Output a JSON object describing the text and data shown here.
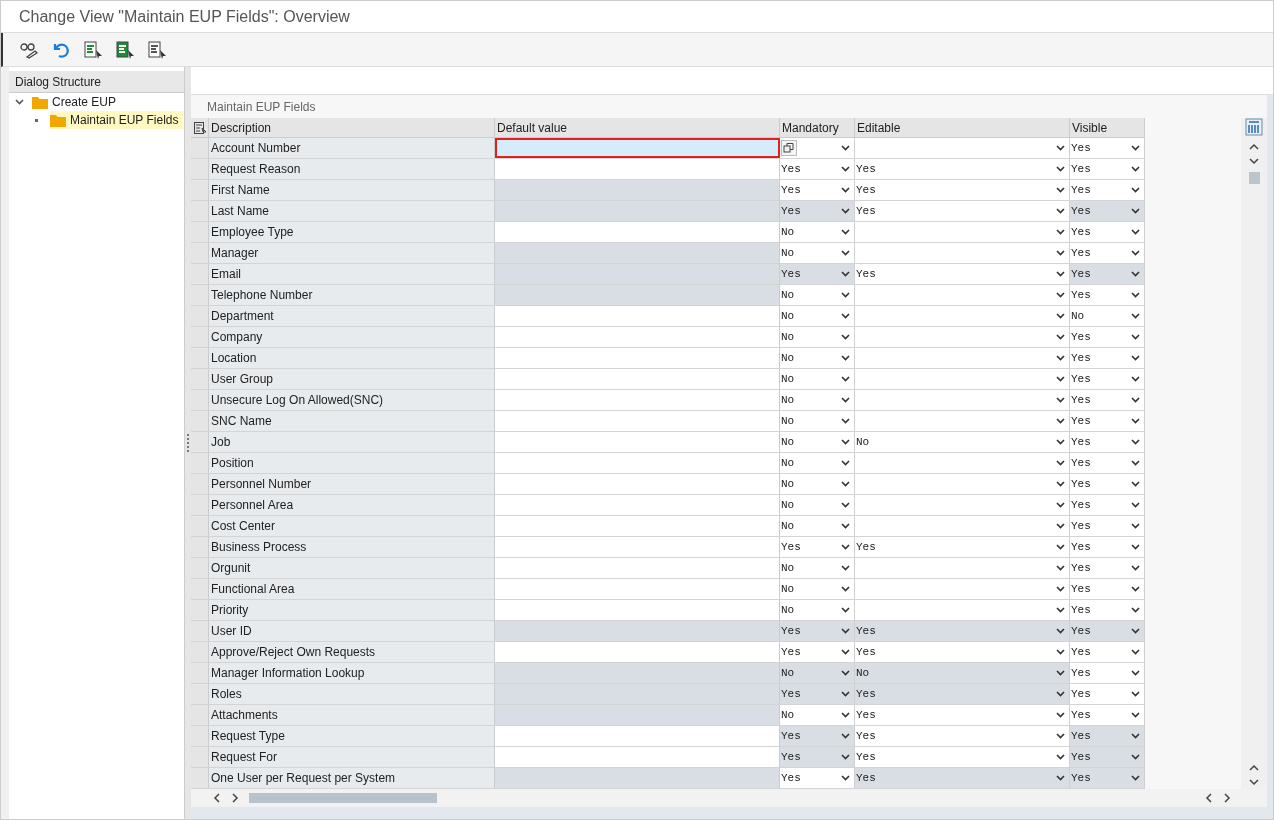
{
  "window": {
    "title": "Change View \"Maintain EUP Fields\": Overview"
  },
  "dialog_structure": {
    "title": "Dialog Structure",
    "tree": [
      {
        "label": "Create EUP",
        "expanded": true,
        "selected": false,
        "children": [
          {
            "label": "Maintain EUP Fields",
            "selected": true
          }
        ]
      }
    ]
  },
  "table": {
    "title": "Maintain EUP Fields",
    "columns": [
      "Description",
      "Default value",
      "Mandatory",
      "Editable",
      "Visible"
    ],
    "rows": [
      {
        "description": "Account Number",
        "default_value": {
          "disabled": false,
          "focused": true
        },
        "mandatory": {
          "disabled": false
        },
        "editable": {
          "disabled": false
        },
        "visible": {
          "value": "Yes",
          "disabled": false
        }
      },
      {
        "description": "Request Reason",
        "default_value": {
          "disabled": false,
          "focused": false
        },
        "mandatory": {
          "value": "Yes",
          "disabled": false
        },
        "editable": {
          "value": "Yes",
          "disabled": false
        },
        "visible": {
          "value": "Yes",
          "disabled": false
        }
      },
      {
        "description": "First Name",
        "default_value": {
          "disabled": true,
          "focused": false
        },
        "mandatory": {
          "value": "Yes",
          "disabled": false
        },
        "editable": {
          "value": "Yes",
          "disabled": false
        },
        "visible": {
          "value": "Yes",
          "disabled": false
        }
      },
      {
        "description": "Last Name",
        "default_value": {
          "disabled": true,
          "focused": false
        },
        "mandatory": {
          "value": "Yes",
          "disabled": true
        },
        "editable": {
          "value": "Yes",
          "disabled": false
        },
        "visible": {
          "value": "Yes",
          "disabled": true
        }
      },
      {
        "description": "Employee Type",
        "default_value": {
          "disabled": false,
          "focused": false
        },
        "mandatory": {
          "value": "No",
          "disabled": false
        },
        "editable": {
          "disabled": false
        },
        "visible": {
          "value": "Yes",
          "disabled": false
        }
      },
      {
        "description": "Manager",
        "default_value": {
          "disabled": true,
          "focused": false
        },
        "mandatory": {
          "value": "No",
          "disabled": false
        },
        "editable": {
          "disabled": false
        },
        "visible": {
          "value": "Yes",
          "disabled": false
        }
      },
      {
        "description": "Email",
        "default_value": {
          "disabled": true,
          "focused": false
        },
        "mandatory": {
          "value": "Yes",
          "disabled": true
        },
        "editable": {
          "value": "Yes",
          "disabled": false
        },
        "visible": {
          "value": "Yes",
          "disabled": true
        }
      },
      {
        "description": "Telephone Number",
        "default_value": {
          "disabled": true,
          "focused": false
        },
        "mandatory": {
          "value": "No",
          "disabled": false
        },
        "editable": {
          "disabled": false
        },
        "visible": {
          "value": "Yes",
          "disabled": false
        }
      },
      {
        "description": "Department",
        "default_value": {
          "disabled": false,
          "focused": false
        },
        "mandatory": {
          "value": "No",
          "disabled": false
        },
        "editable": {
          "disabled": false
        },
        "visible": {
          "value": "No",
          "disabled": false
        }
      },
      {
        "description": "Company",
        "default_value": {
          "disabled": false,
          "focused": false
        },
        "mandatory": {
          "value": "No",
          "disabled": false
        },
        "editable": {
          "disabled": false
        },
        "visible": {
          "value": "Yes",
          "disabled": false
        }
      },
      {
        "description": "Location",
        "default_value": {
          "disabled": false,
          "focused": false
        },
        "mandatory": {
          "value": "No",
          "disabled": false
        },
        "editable": {
          "disabled": false
        },
        "visible": {
          "value": "Yes",
          "disabled": false
        }
      },
      {
        "description": "User Group",
        "default_value": {
          "disabled": false,
          "focused": false
        },
        "mandatory": {
          "value": "No",
          "disabled": false
        },
        "editable": {
          "disabled": false
        },
        "visible": {
          "value": "Yes",
          "disabled": false
        }
      },
      {
        "description": "Unsecure Log On Allowed(SNC)",
        "default_value": {
          "disabled": false,
          "focused": false
        },
        "mandatory": {
          "value": "No",
          "disabled": false
        },
        "editable": {
          "disabled": false
        },
        "visible": {
          "value": "Yes",
          "disabled": false
        }
      },
      {
        "description": "SNC Name",
        "default_value": {
          "disabled": false,
          "focused": false
        },
        "mandatory": {
          "value": "No",
          "disabled": false
        },
        "editable": {
          "disabled": false
        },
        "visible": {
          "value": "Yes",
          "disabled": false
        }
      },
      {
        "description": "Job",
        "default_value": {
          "disabled": false,
          "focused": false
        },
        "mandatory": {
          "value": "No",
          "disabled": false
        },
        "editable": {
          "value": "No",
          "disabled": false
        },
        "visible": {
          "value": "Yes",
          "disabled": false
        }
      },
      {
        "description": "Position",
        "default_value": {
          "disabled": false,
          "focused": false
        },
        "mandatory": {
          "value": "No",
          "disabled": false
        },
        "editable": {
          "disabled": false
        },
        "visible": {
          "value": "Yes",
          "disabled": false
        }
      },
      {
        "description": "Personnel Number",
        "default_value": {
          "disabled": false,
          "focused": false
        },
        "mandatory": {
          "value": "No",
          "disabled": false
        },
        "editable": {
          "disabled": false
        },
        "visible": {
          "value": "Yes",
          "disabled": false
        }
      },
      {
        "description": "Personnel Area",
        "default_value": {
          "disabled": false,
          "focused": false
        },
        "mandatory": {
          "value": "No",
          "disabled": false
        },
        "editable": {
          "disabled": false
        },
        "visible": {
          "value": "Yes",
          "disabled": false
        }
      },
      {
        "description": "Cost Center",
        "default_value": {
          "disabled": false,
          "focused": false
        },
        "mandatory": {
          "value": "No",
          "disabled": false
        },
        "editable": {
          "disabled": false
        },
        "visible": {
          "value": "Yes",
          "disabled": false
        }
      },
      {
        "description": "Business Process",
        "default_value": {
          "disabled": false,
          "focused": false
        },
        "mandatory": {
          "value": "Yes",
          "disabled": false
        },
        "editable": {
          "value": "Yes",
          "disabled": false
        },
        "visible": {
          "value": "Yes",
          "disabled": false
        }
      },
      {
        "description": "Orgunit",
        "default_value": {
          "disabled": false,
          "focused": false
        },
        "mandatory": {
          "value": "No",
          "disabled": false
        },
        "editable": {
          "disabled": false
        },
        "visible": {
          "value": "Yes",
          "disabled": false
        }
      },
      {
        "description": "Functional Area",
        "default_value": {
          "disabled": false,
          "focused": false
        },
        "mandatory": {
          "value": "No",
          "disabled": false
        },
        "editable": {
          "disabled": false
        },
        "visible": {
          "value": "Yes",
          "disabled": false
        }
      },
      {
        "description": "Priority",
        "default_value": {
          "disabled": false,
          "focused": false
        },
        "mandatory": {
          "value": "No",
          "disabled": false
        },
        "editable": {
          "disabled": false
        },
        "visible": {
          "value": "Yes",
          "disabled": false
        }
      },
      {
        "description": "User ID",
        "default_value": {
          "disabled": true,
          "focused": false
        },
        "mandatory": {
          "value": "Yes",
          "disabled": true
        },
        "editable": {
          "value": "Yes",
          "disabled": true
        },
        "visible": {
          "value": "Yes",
          "disabled": true
        }
      },
      {
        "description": "Approve/Reject Own Requests",
        "default_value": {
          "disabled": false,
          "focused": false
        },
        "mandatory": {
          "value": "Yes",
          "disabled": false
        },
        "editable": {
          "value": "Yes",
          "disabled": false
        },
        "visible": {
          "value": "Yes",
          "disabled": false
        }
      },
      {
        "description": "Manager Information Lookup",
        "default_value": {
          "disabled": true,
          "focused": false
        },
        "mandatory": {
          "value": "No",
          "disabled": true
        },
        "editable": {
          "value": "No",
          "disabled": true
        },
        "visible": {
          "value": "Yes",
          "disabled": false
        }
      },
      {
        "description": "Roles",
        "default_value": {
          "disabled": true,
          "focused": false
        },
        "mandatory": {
          "value": "Yes",
          "disabled": true
        },
        "editable": {
          "value": "Yes",
          "disabled": true
        },
        "visible": {
          "value": "Yes",
          "disabled": false
        }
      },
      {
        "description": "Attachments",
        "default_value": {
          "disabled": true,
          "focused": false
        },
        "mandatory": {
          "value": "No",
          "disabled": false
        },
        "editable": {
          "value": "Yes",
          "disabled": false
        },
        "visible": {
          "value": "Yes",
          "disabled": false
        }
      },
      {
        "description": "Request Type",
        "default_value": {
          "disabled": false,
          "focused": false
        },
        "mandatory": {
          "value": "Yes",
          "disabled": true
        },
        "editable": {
          "value": "Yes",
          "disabled": false
        },
        "visible": {
          "value": "Yes",
          "disabled": true
        }
      },
      {
        "description": "Request For",
        "default_value": {
          "disabled": false,
          "focused": false
        },
        "mandatory": {
          "value": "Yes",
          "disabled": true
        },
        "editable": {
          "value": "Yes",
          "disabled": false
        },
        "visible": {
          "value": "Yes",
          "disabled": true
        }
      },
      {
        "description": "One User per Request per System",
        "default_value": {
          "disabled": true,
          "focused": false
        },
        "mandatory": {
          "value": "Yes",
          "disabled": false
        },
        "editable": {
          "value": "Yes",
          "disabled": true
        },
        "visible": {
          "value": "Yes",
          "disabled": true
        }
      }
    ]
  }
}
